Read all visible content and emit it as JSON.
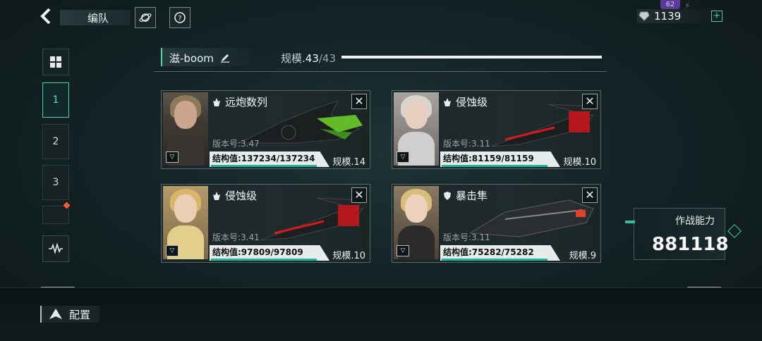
{
  "header": {
    "title": "编队",
    "back_icon": "back-arrow-icon"
  },
  "resources": {
    "badge": "62",
    "amount": "1139",
    "plus": "+"
  },
  "nav": {
    "tabs": [
      "1",
      "2",
      "3"
    ]
  },
  "fleet": {
    "name": "滋-boom",
    "scale_label": "规模.",
    "scale_current": "43",
    "scale_sep": "/43"
  },
  "cards": [
    {
      "name": "远炮数列",
      "version": "版本号:3.47",
      "hp": "结构值:137234/137234",
      "scale": "规模.14",
      "hp_fraction": 1.0
    },
    {
      "name": "侵蚀级",
      "version": "版本号:3.11",
      "hp": "结构值:81159/81159",
      "scale": "规模.10",
      "hp_fraction": 1.0
    },
    {
      "name": "侵蚀级",
      "version": "版本号:3.41",
      "hp": "结构值:97809/97809",
      "scale": "规模.10",
      "hp_fraction": 1.0
    },
    {
      "name": "暴击隼",
      "version": "版本号:3.11",
      "hp": "结构值:75282/75282",
      "scale": "规模.9",
      "hp_fraction": 1.0
    }
  ],
  "power": {
    "label": "作战能力",
    "value": "881118"
  },
  "footer": {
    "config_label": "配置"
  },
  "colors": {
    "accent": "#3fd1a6",
    "panel": "#1a2627"
  }
}
